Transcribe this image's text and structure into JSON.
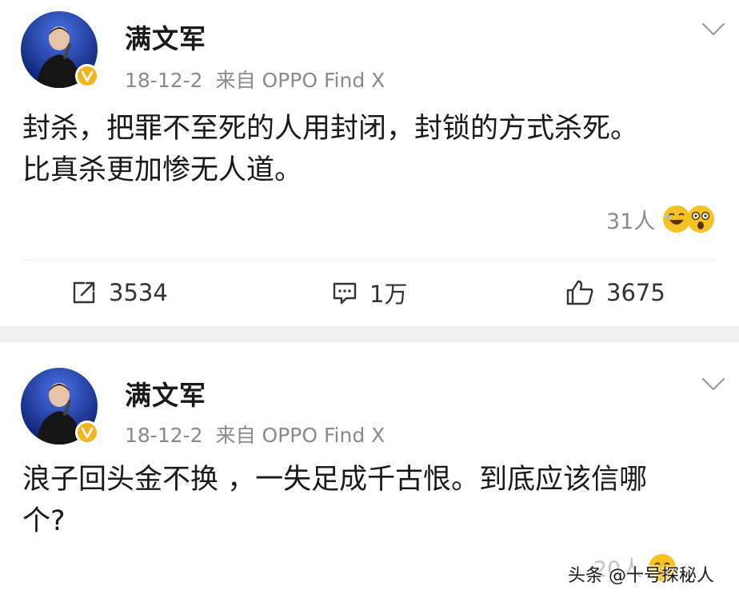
{
  "posts": [
    {
      "author": "满文军",
      "date": "18-12-2",
      "source": "来自 OPPO Find X",
      "content_lines": [
        "封杀，把罪不至死的人用封闭，封锁的方式杀死。",
        "比真杀更加惨无人道。"
      ],
      "reaction_count": "31人",
      "reaction_icons": [
        "laughing-emoji-icon",
        "surprised-emoji-icon"
      ],
      "actions": {
        "repost_count": "3534",
        "comment_count": "1万",
        "like_count": "3675"
      }
    },
    {
      "author": "满文军",
      "date": "18-12-2",
      "source": "来自 OPPO Find X",
      "content_lines": [
        "浪子回头金不换 ，一失足成千古恨。到底应该信哪",
        "个?"
      ],
      "reaction_count": "20人",
      "reaction_icons": [
        "smile-emoji-icon"
      ]
    }
  ],
  "watermark": "头条 @十号探秘人",
  "colors": {
    "verified_badge": "#f2b51a",
    "secondary_text": "#8a8a8a",
    "separator": "#f0f0f0"
  }
}
